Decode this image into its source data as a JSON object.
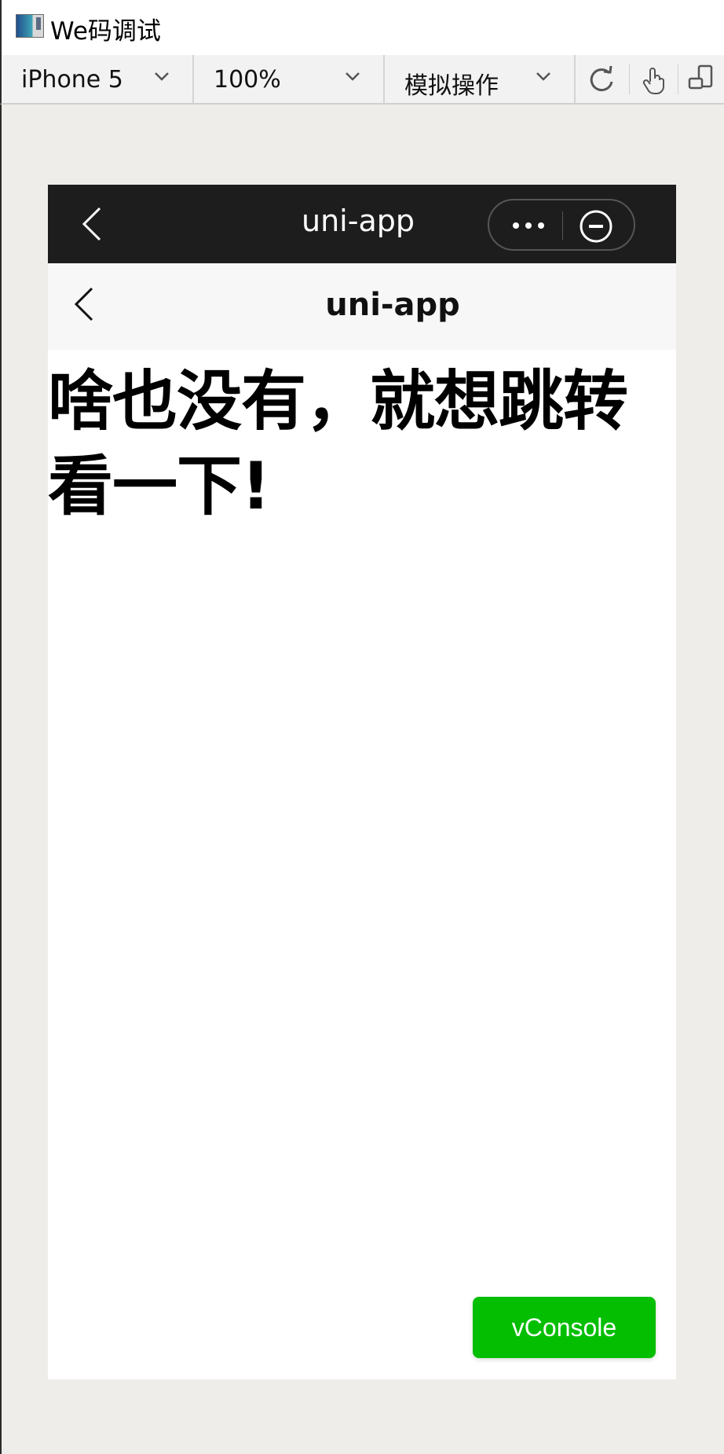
{
  "window": {
    "title": "We码调试"
  },
  "toolbar": {
    "device_label": "iPhone 5",
    "zoom_label": "100%",
    "mode_label": "模拟操作"
  },
  "phone": {
    "wx_nav_title": "uni-app",
    "page_title": "uni-app",
    "headline": "啥也没有，就想跳转看一下!",
    "vconsole_label": "vConsole"
  },
  "colors": {
    "wx_nav_bg": "#1d1d1d",
    "page_nav_bg": "#f7f7f7",
    "vconsole_green": "#04be02"
  },
  "icons": [
    "app-icon",
    "chevron-down-icon",
    "refresh-icon",
    "touch-icon",
    "device-rotate-icon",
    "back-arrow-icon",
    "more-icon",
    "close-circle-icon"
  ]
}
